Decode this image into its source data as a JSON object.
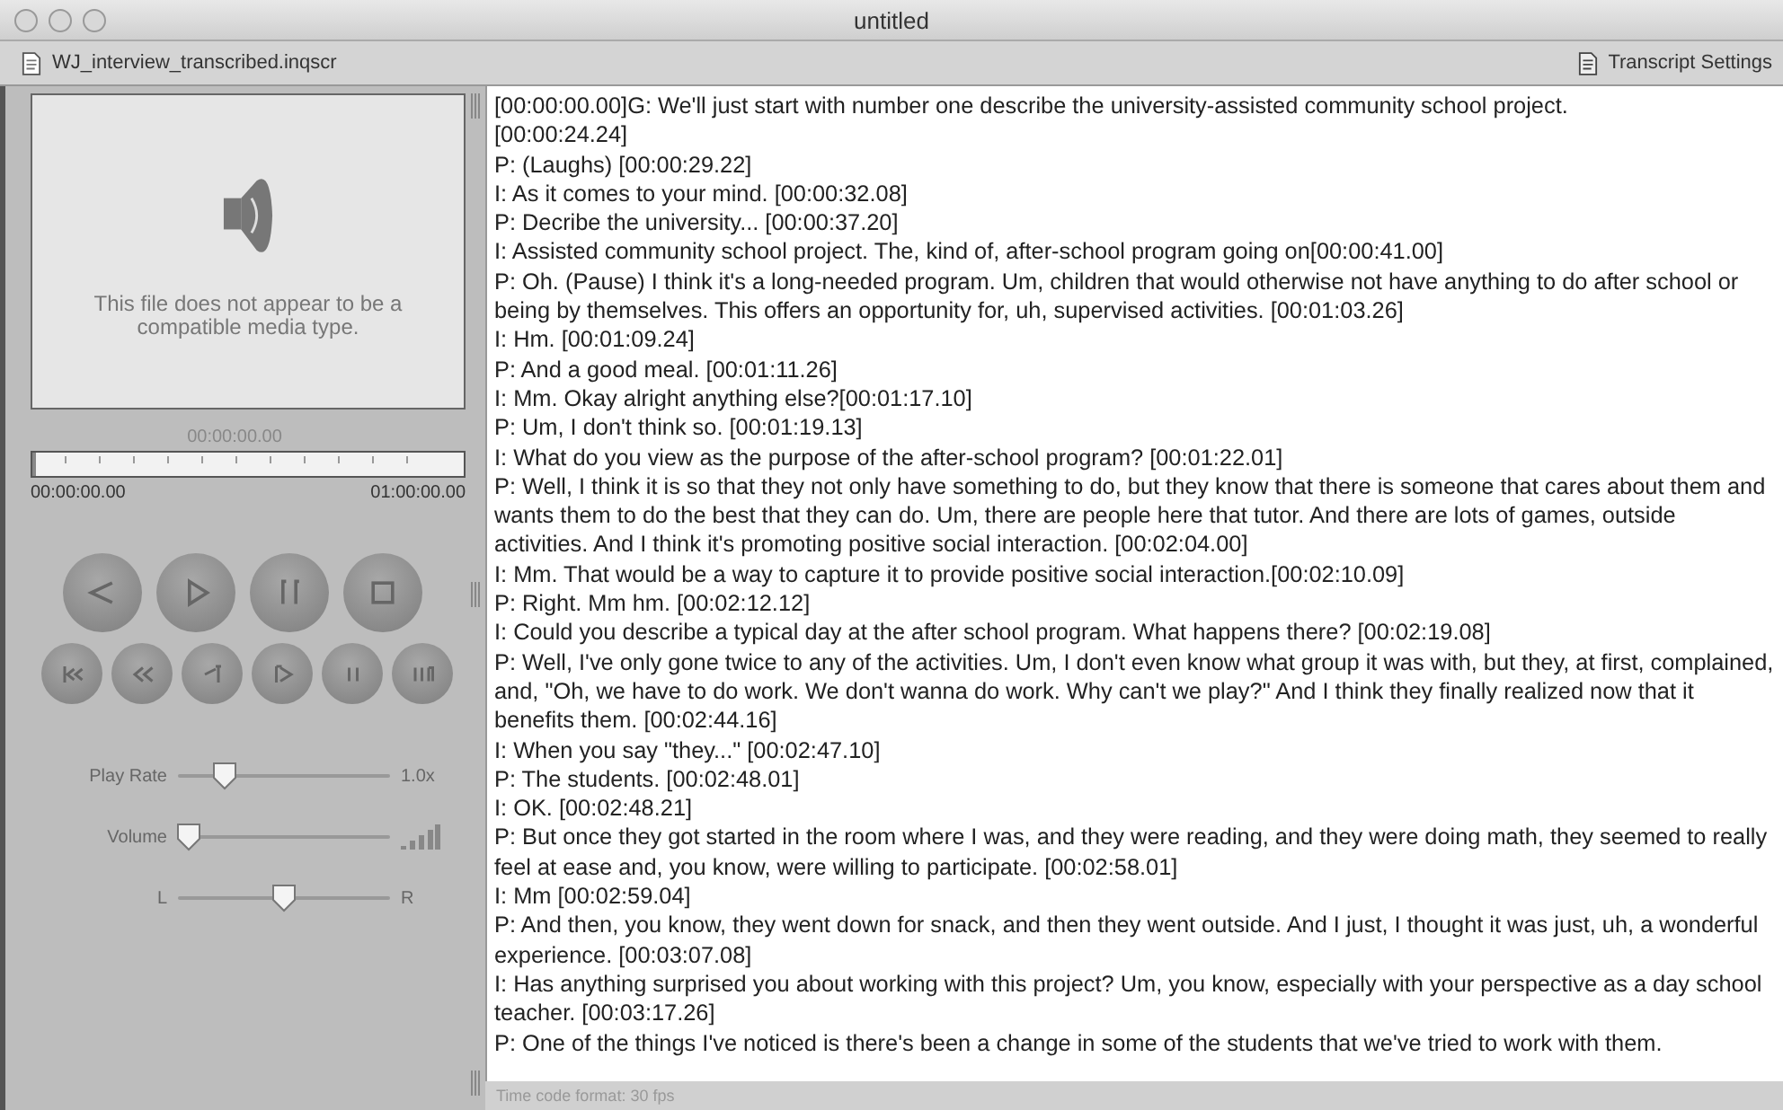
{
  "window": {
    "title": "untitled"
  },
  "toolbar": {
    "file_name": "WJ_interview_transcribed.inqscr",
    "settings_button": "Transcript Settings"
  },
  "player": {
    "message": "This file does not appear to be a compatible media type.",
    "current_time": "00:00:00.00",
    "start_time": "00:00:00.00",
    "end_time": "01:00:00.00",
    "timeline": {
      "level": 0
    },
    "sliders": [
      {
        "kind": "rate",
        "label": "Play Rate",
        "level": 0.22,
        "reading": "1.0x"
      },
      {
        "kind": "volume",
        "label": "Volume",
        "level": 0.05
      },
      {
        "kind": "balance",
        "left_label": "L",
        "level": 0.5,
        "right_label": "R"
      }
    ]
  },
  "transcript": {
    "paragraphs": [
      "[00:00:00.00]G: We'll just start with number one describe the university-assisted community school project.",
      "[00:00:24.24]",
      "P: (Laughs) [00:00:29.22]",
      "I: As it comes to your mind. [00:00:32.08]",
      "P: Decribe the university... [00:00:37.20]",
      "I: Assisted community school project.  The, kind of, after-school program going on[00:00:41.00]",
      "P: Oh. (Pause) I think it's a long-needed program. Um, children that would otherwise not have anything to do after school or being by themselves.  This offers an opportunity for, uh, supervised activities. [00:01:03.26]",
      "I: Hm. [00:01:09.24]",
      "P: And a good meal. [00:01:11.26]",
      "I: Mm. Okay alright anything else?[00:01:17.10]",
      "P: Um, I don't think so. [00:01:19.13]",
      "I: What do you view as the purpose of the after-school program? [00:01:22.01]",
      "P: Well, I think it is so that they not only have something to do, but they know that there is someone that cares about them and wants them to do the best that they can do.  Um, there are people here that tutor.  And there are lots of games, outside activities.  And I think it's promoting positive social interaction. [00:02:04.00]",
      "I: Mm.  That would be a way to capture it to provide positive social interaction.[00:02:10.09]",
      "P: Right.  Mm hm. [00:02:12.12]",
      "I: Could you describe a typical day at the after school program.  What happens there? [00:02:19.08]",
      "P: Well, I've only gone twice to any of the activities.  Um, I don't even know what group it was with, but they, at first, complained, and, \"Oh, we have to do work.  We don't wanna do work.  Why can't we play?\" And I think they finally realized now that it benefits them. [00:02:44.16]",
      "I: When you say \"they...\" [00:02:47.10]",
      "P: The students. [00:02:48.01]",
      "I: OK. [00:02:48.21]",
      "P: But once they got started in the room where I was, and they were reading, and they were doing math, they seemed to really feel at ease and, you know, were willing to participate. [00:02:58.01]",
      "I: Mm [00:02:59.04]",
      "P: And then, you know, they went down for snack, and then they went outside.  And I just, I thought it was just, uh, a wonderful experience. [00:03:07.08]",
      "I: Has anything surprised you about working with this project? Um, you know, especially with your perspective as a day school teacher. [00:03:17.26]",
      "P: One of the things I've noticed is there's been a change in some of the students that we've tried to work with them."
    ]
  },
  "status_bar": "Time code format: 30 fps"
}
